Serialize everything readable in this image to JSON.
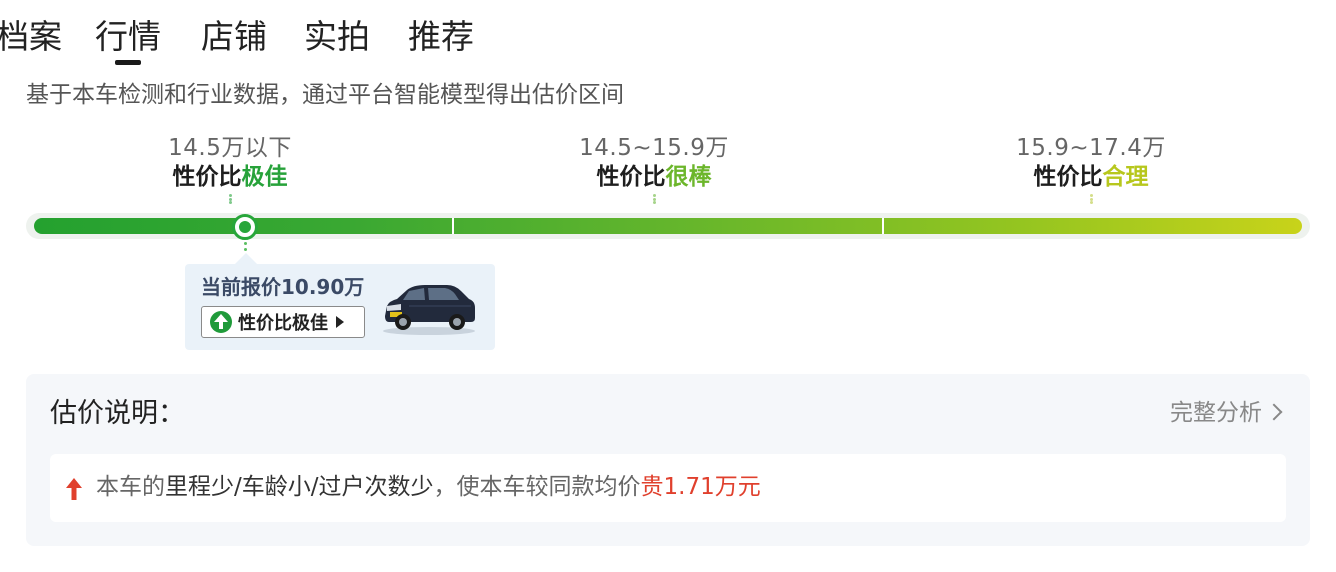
{
  "tabs": [
    {
      "label": "档案"
    },
    {
      "label": "行情",
      "active": true
    },
    {
      "label": "店铺"
    },
    {
      "label": "实拍"
    },
    {
      "label": "推荐"
    }
  ],
  "intro": "基于本车检测和行业数据，通过平台智能模型得出估价区间",
  "segments": [
    {
      "range": "14.5万以下",
      "prefix": "性价比",
      "rating": "极佳",
      "color": "#27a23a"
    },
    {
      "range": "14.5~15.9万",
      "prefix": "性价比",
      "rating": "很棒",
      "color": "#6cb62b"
    },
    {
      "range": "15.9~17.4万",
      "prefix": "性价比",
      "rating": "合理",
      "color": "#b7c71d"
    }
  ],
  "current": {
    "price_label": "当前报价10.90万",
    "badge": "性价比极佳",
    "marker_fraction": 0.165
  },
  "explain": {
    "title": "估价说明：",
    "more": "完整分析",
    "line_prefix": "本车的",
    "line_factors": "里程少/车龄小/过户次数少",
    "line_mid": "，使本车较同款均价",
    "line_result": "贵1.71万元"
  },
  "colors": {
    "accent_green": "#27a23a",
    "highlight_red": "#e0402d"
  }
}
